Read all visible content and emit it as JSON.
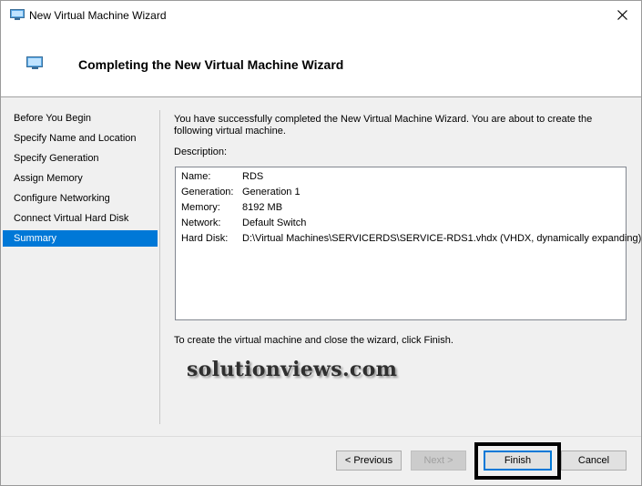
{
  "window": {
    "title": "New Virtual Machine Wizard",
    "close_glyph": "close-icon"
  },
  "header": {
    "title": "Completing the New Virtual Machine Wizard",
    "icon": "virtual-machine-icon"
  },
  "sidebar": {
    "items": [
      {
        "label": "Before You Begin",
        "active": false
      },
      {
        "label": "Specify Name and Location",
        "active": false
      },
      {
        "label": "Specify Generation",
        "active": false
      },
      {
        "label": "Assign Memory",
        "active": false
      },
      {
        "label": "Configure Networking",
        "active": false
      },
      {
        "label": "Connect Virtual Hard Disk",
        "active": false
      },
      {
        "label": "Summary",
        "active": true
      }
    ]
  },
  "main": {
    "intro": "You have successfully completed the New Virtual Machine Wizard. You are about to create the following virtual machine.",
    "description_label": "Description:",
    "description": [
      {
        "key": "Name:",
        "value": "RDS"
      },
      {
        "key": "Generation:",
        "value": "Generation 1"
      },
      {
        "key": "Memory:",
        "value": "8192 MB"
      },
      {
        "key": "Network:",
        "value": "Default Switch"
      },
      {
        "key": "Hard Disk:",
        "value": "D:\\Virtual Machines\\SERVICERDS\\SERVICE-RDS1.vhdx (VHDX, dynamically expanding)"
      }
    ],
    "finish_note": "To create the virtual machine and close the wizard, click Finish.",
    "watermark": "solutionviews.com"
  },
  "buttons": {
    "previous": "< Previous",
    "next": "Next >",
    "finish": "Finish",
    "cancel": "Cancel"
  },
  "colors": {
    "accent": "#0078d7",
    "highlight_frame": "#000000"
  }
}
